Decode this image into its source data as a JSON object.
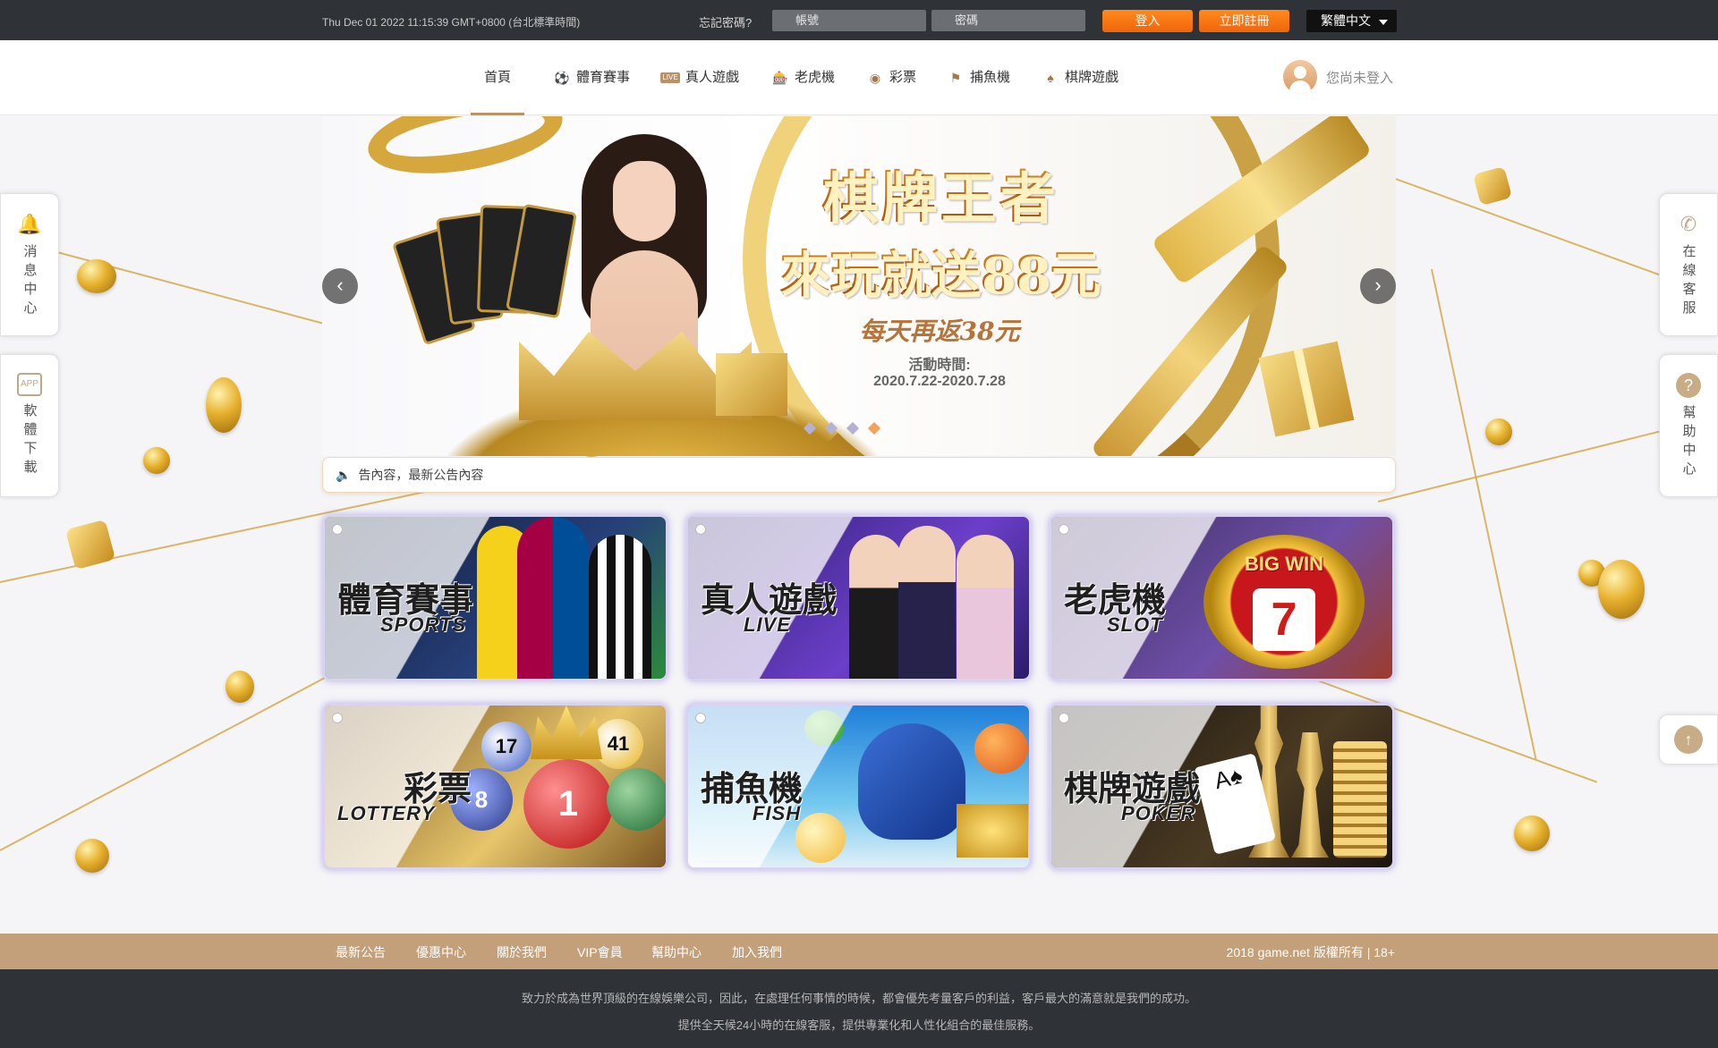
{
  "topbar": {
    "datetime": "Thu Dec 01 2022 11:15:39 GMT+0800 (台北標準時間)",
    "forgot_password": "忘記密碼?",
    "username_placeholder": "帳號",
    "password_placeholder": "密碼",
    "login_label": "登入",
    "register_label": "立即註冊",
    "language": "繁體中文",
    "accent_color": "#f07c15"
  },
  "nav": {
    "items": [
      {
        "label": "首頁",
        "icon": "none"
      },
      {
        "label": "體育賽事",
        "icon": "soccer-ball-icon"
      },
      {
        "label": "真人遊戲",
        "icon": "live-badge-icon"
      },
      {
        "label": "老虎機",
        "icon": "slot-machine-icon"
      },
      {
        "label": "彩票",
        "icon": "lottery-ball-icon"
      },
      {
        "label": "捕魚機",
        "icon": "fishing-icon"
      },
      {
        "label": "棋牌遊戲",
        "icon": "cards-icon"
      }
    ],
    "user_status": "您尚未登入"
  },
  "banner": {
    "headline1": "棋牌王者",
    "headline2": "來玩就送88元",
    "headline3": "每天再返38元",
    "period_label": "活動時間:",
    "period": "2020.7.22-2020.7.28",
    "slide_count": 4,
    "active_slide": 4
  },
  "marquee": {
    "text": "告內容，最新公告內容"
  },
  "games": [
    {
      "title": "體育賽事",
      "subtitle": "SPORTS"
    },
    {
      "title": "真人遊戲",
      "subtitle": "LIVE"
    },
    {
      "title": "老虎機",
      "subtitle": "SLOT",
      "badge": "BIG WIN",
      "badge_num": "7"
    },
    {
      "title": "彩票",
      "subtitle": "LOTTERY",
      "balls": [
        "17",
        "41",
        "8",
        "1"
      ]
    },
    {
      "title": "捕魚機",
      "subtitle": "FISH"
    },
    {
      "title": "棋牌遊戲",
      "subtitle": "POKER"
    }
  ],
  "side_left": [
    {
      "label": "消息中心",
      "icon": "bell-icon"
    },
    {
      "label": "軟體下載",
      "icon": "app-download-icon"
    }
  ],
  "side_right": [
    {
      "label": "在線客服",
      "icon": "phone-icon"
    },
    {
      "label": "幫助中心",
      "icon": "help-icon"
    }
  ],
  "back_to_top": {
    "icon": "arrow-up-icon"
  },
  "footer": {
    "links": [
      "最新公告",
      "優惠中心",
      "關於我們",
      "VIP會員",
      "幫助中心",
      "加入我們"
    ],
    "copyright": "2018 game.net 版權所有 | 18+",
    "line1": "致力於成為世界頂級的在線娛樂公司，因此，在處理任何事情的時候，都會優先考量客戶的利益，客戶最大的滿意就是我們的成功。",
    "line2": "提供全天候24小時的在線客服，提供專業化和人性化組合的最佳服務。"
  }
}
